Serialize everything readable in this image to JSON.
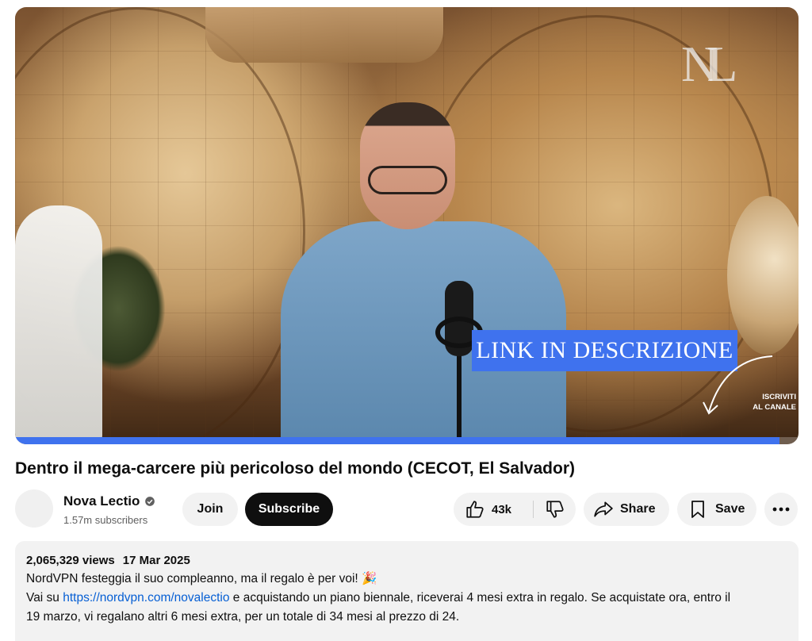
{
  "video": {
    "overlay_banner": "LINK IN DESCRIZIONE",
    "overlay_subscribe_line1": "ISCRIVITI",
    "overlay_subscribe_line2": "AL CANALE",
    "logo_text": "NL",
    "progress_fraction": 0.976
  },
  "title": "Dentro il mega-carcere più pericoloso del mondo (CECOT, El Salvador)",
  "channel": {
    "name": "Nova Lectio",
    "subscribers": "1.57m subscribers",
    "verified_icon": "verified-check-icon"
  },
  "actions": {
    "join_label": "Join",
    "subscribe_label": "Subscribe",
    "like_count": "43k",
    "share_label": "Share",
    "save_label": "Save"
  },
  "description": {
    "views": "2,065,329 views",
    "date": "17 Mar 2025",
    "line1": "NordVPN festeggia il suo compleanno, ma il regalo è per voi! 🎉",
    "line2_prefix": "Vai su ",
    "line2_link": "https://nordvpn.com/novalectio",
    "line2_suffix": " e acquistando un piano biennale, riceverai 4 mesi extra in regalo. Se acquistate ora, entro il",
    "line3": "19 marzo, vi regalano altri 6 mesi extra, per un totale di 34 mesi al prezzo di 24."
  },
  "colors": {
    "accent_blue": "#3f72ee",
    "link_blue": "#065fd4",
    "subscribe_bg": "#0f0f0f",
    "pill_bg": "#f2f2f2"
  }
}
